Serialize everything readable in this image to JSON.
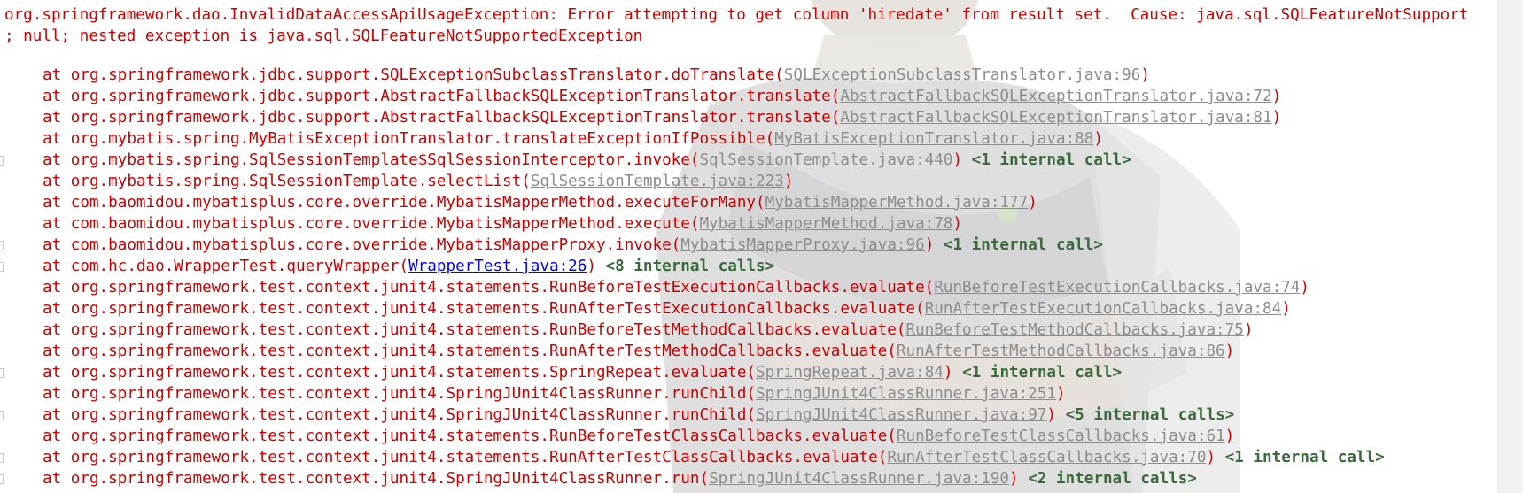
{
  "exception": {
    "line1": "org.springframework.dao.InvalidDataAccessApiUsageException: Error attempting to get column 'hiredate' from result set.  Cause: java.sql.SQLFeatureNotSupport",
    "line2": "; null; nested exception is java.sql.SQLFeatureNotSupportedException"
  },
  "frames": [
    {
      "prefix": "at org.springframework.jdbc.support.SQLExceptionSubclassTranslator.doTranslate(",
      "link": "SQLExceptionSubclassTranslator.java:96",
      "suffix": ")",
      "internal": ""
    },
    {
      "prefix": "at org.springframework.jdbc.support.AbstractFallbackSQLExceptionTranslator.translate(",
      "link": "AbstractFallbackSQLExceptionTranslator.java:72",
      "suffix": ")",
      "internal": ""
    },
    {
      "prefix": "at org.springframework.jdbc.support.AbstractFallbackSQLExceptionTranslator.translate(",
      "link": "AbstractFallbackSQLExceptionTranslator.java:81",
      "suffix": ")",
      "internal": ""
    },
    {
      "prefix": "at org.mybatis.spring.MyBatisExceptionTranslator.translateExceptionIfPossible(",
      "link": "MyBatisExceptionTranslator.java:88",
      "suffix": ")",
      "internal": ""
    },
    {
      "prefix": "at org.mybatis.spring.SqlSessionTemplate$SqlSessionInterceptor.invoke(",
      "link": "SqlSessionTemplate.java:440",
      "suffix": ")",
      "internal": " <1 internal call>"
    },
    {
      "prefix": "at org.mybatis.spring.SqlSessionTemplate.selectList(",
      "link": "SqlSessionTemplate.java:223",
      "suffix": ")",
      "internal": ""
    },
    {
      "prefix": "at com.baomidou.mybatisplus.core.override.MybatisMapperMethod.executeForMany(",
      "link": "MybatisMapperMethod.java:177",
      "suffix": ")",
      "internal": ""
    },
    {
      "prefix": "at com.baomidou.mybatisplus.core.override.MybatisMapperMethod.execute(",
      "link": "MybatisMapperMethod.java:78",
      "suffix": ")",
      "internal": ""
    },
    {
      "prefix": "at com.baomidou.mybatisplus.core.override.MybatisMapperProxy.invoke(",
      "link": "MybatisMapperProxy.java:96",
      "suffix": ")",
      "internal": " <1 internal call>"
    },
    {
      "prefix": "at com.hc.dao.WrapperTest.queryWrapper(",
      "link": "WrapperTest.java:26",
      "suffix": ")",
      "internal": " <8 internal calls>"
    },
    {
      "prefix": "at org.springframework.test.context.junit4.statements.RunBeforeTestExecutionCallbacks.evaluate(",
      "link": "RunBeforeTestExecutionCallbacks.java:74",
      "suffix": ")",
      "internal": ""
    },
    {
      "prefix": "at org.springframework.test.context.junit4.statements.RunAfterTestExecutionCallbacks.evaluate(",
      "link": "RunAfterTestExecutionCallbacks.java:84",
      "suffix": ")",
      "internal": ""
    },
    {
      "prefix": "at org.springframework.test.context.junit4.statements.RunBeforeTestMethodCallbacks.evaluate(",
      "link": "RunBeforeTestMethodCallbacks.java:75",
      "suffix": ")",
      "internal": ""
    },
    {
      "prefix": "at org.springframework.test.context.junit4.statements.RunAfterTestMethodCallbacks.evaluate(",
      "link": "RunAfterTestMethodCallbacks.java:86",
      "suffix": ")",
      "internal": ""
    },
    {
      "prefix": "at org.springframework.test.context.junit4.statements.SpringRepeat.evaluate(",
      "link": "SpringRepeat.java:84",
      "suffix": ")",
      "internal": " <1 internal call>"
    },
    {
      "prefix": "at org.springframework.test.context.junit4.SpringJUnit4ClassRunner.runChild(",
      "link": "SpringJUnit4ClassRunner.java:251",
      "suffix": ")",
      "internal": ""
    },
    {
      "prefix": "at org.springframework.test.context.junit4.SpringJUnit4ClassRunner.runChild(",
      "link": "SpringJUnit4ClassRunner.java:97",
      "suffix": ")",
      "internal": " <5 internal calls>"
    },
    {
      "prefix": "at org.springframework.test.context.junit4.statements.RunBeforeTestClassCallbacks.evaluate(",
      "link": "RunBeforeTestClassCallbacks.java:61",
      "suffix": ")",
      "internal": ""
    },
    {
      "prefix": "at org.springframework.test.context.junit4.statements.RunAfterTestClassCallbacks.evaluate(",
      "link": "RunAfterTestClassCallbacks.java:70",
      "suffix": ")",
      "internal": " <1 internal call>"
    },
    {
      "prefix": "at org.springframework.test.context.junit4.SpringJUnit4ClassRunner.run(",
      "link": "SpringJUnit4ClassRunner.java:190",
      "suffix": ")",
      "internal": " <2 internal calls>"
    }
  ],
  "colors": {
    "error_text": "#ca0000",
    "library_link": "#8c8c8c",
    "user_link": "#0000ff",
    "internal_calls": "#3a6a3a"
  }
}
